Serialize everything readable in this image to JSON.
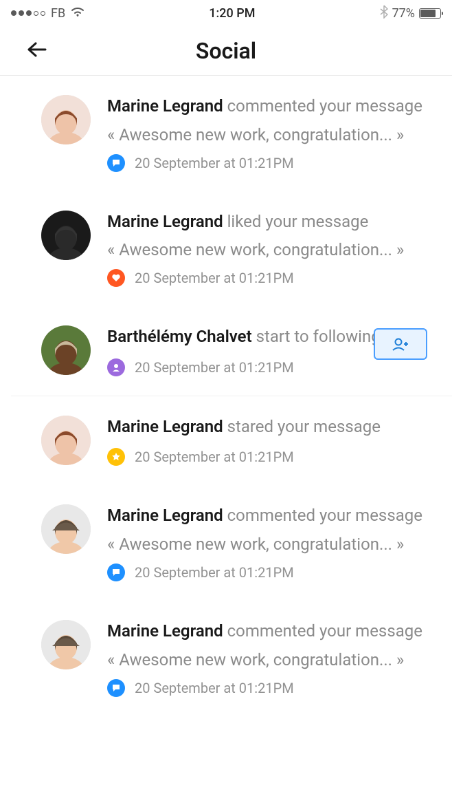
{
  "status_bar": {
    "carrier": "FB",
    "time": "1:20 PM",
    "battery_pct": "77%"
  },
  "header": {
    "title": "Social"
  },
  "notifications": [
    {
      "actor": "Marine Legrand",
      "action": "commented your message",
      "quote": "« Awesome new work, congratulation... »",
      "timestamp": "20 September at 01:21PM",
      "type": "comment",
      "avatar_variant": "a"
    },
    {
      "actor": "Marine Legrand",
      "action": "liked your message",
      "quote": "« Awesome new work, congratulation... »",
      "timestamp": "20 September at 01:21PM",
      "type": "like",
      "avatar_variant": "b"
    },
    {
      "actor": "Barthélémy Chalvet",
      "action": "start to following you",
      "quote": "",
      "timestamp": "20 September at 01:21PM",
      "type": "follow",
      "has_follow_button": true,
      "avatar_variant": "c"
    },
    {
      "actor": "Marine Legrand",
      "action": "stared your message",
      "quote": "",
      "timestamp": "20 September at 01:21PM",
      "type": "star",
      "avatar_variant": "a"
    },
    {
      "actor": "Marine Legrand",
      "action": "commented your message",
      "quote": "« Awesome new work, congratulation... »",
      "timestamp": "20 September at 01:21PM",
      "type": "comment",
      "avatar_variant": "d"
    },
    {
      "actor": "Marine Legrand",
      "action": "commented your message",
      "quote": "« Awesome new work, congratulation... »",
      "timestamp": "20 September at 01:21PM",
      "type": "comment",
      "avatar_variant": "d"
    }
  ]
}
